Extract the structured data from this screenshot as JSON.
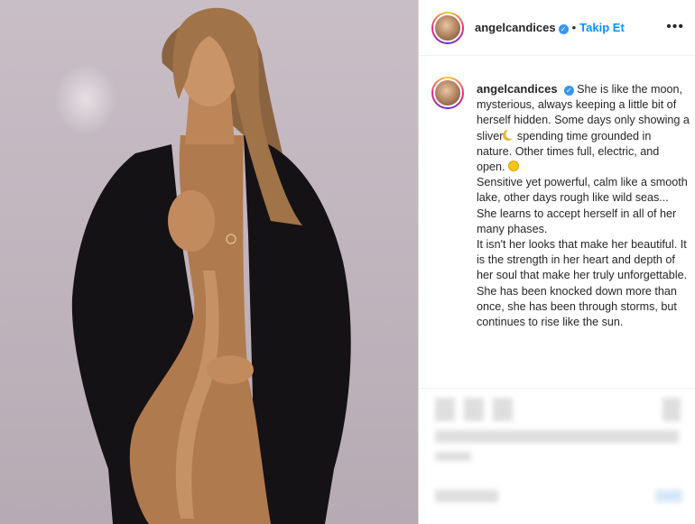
{
  "post": {
    "username": "angelcandices",
    "follow_label": "Takip Et",
    "separator": "•",
    "more_icon": "•••",
    "verified_icon": "✓",
    "caption_lines": [
      "She is like the moon, mysterious, always keeping a little bit of herself hidden. Some days only showing a sliver",
      "spending time grounded in nature. Other times full, electric, and open.",
      "Sensitive yet powerful, calm like a smooth lake, other days rough like wild seas...",
      "She learns to accept herself in all of her many phases.",
      "It isn't her looks that make her beautiful.  It is the strength in her heart and depth of her soul that make her truly unforgettable.",
      "She has been knocked down more than once, she has been through storms, but continues to rise like the sun."
    ]
  },
  "colors": {
    "accent": "#0095f6",
    "verified": "#3897f0",
    "text": "#262626",
    "photo_background": "#c4b8c1",
    "coat": "#141214",
    "skin": "#b07a4f"
  }
}
